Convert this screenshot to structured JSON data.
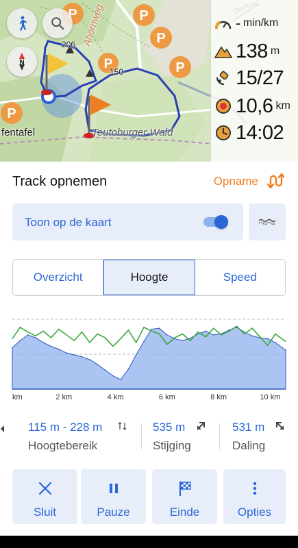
{
  "map": {
    "labels": {
      "road": "Ahornweg",
      "height1": "206",
      "height2": "150",
      "place_left": "fentafel",
      "place_bottom": "Teutoburger Wald",
      "road_top": "genbac"
    },
    "compass": "N"
  },
  "widgets": {
    "speed": {
      "value": "-",
      "unit": "min/km"
    },
    "altitude": {
      "value": "138",
      "unit": "m"
    },
    "satellites": {
      "value": "15/27"
    },
    "distance": {
      "value": "10,6",
      "unit": "km"
    },
    "time": {
      "value": "14:02"
    }
  },
  "sheet": {
    "title": "Track opnemen",
    "record_label": "Opname",
    "show_on_map_label": "Toon op de kaart",
    "tabs": [
      "Overzicht",
      "Hoogte",
      "Speed"
    ],
    "active_tab": "Hoogte"
  },
  "chart_data": {
    "type": "area",
    "xlabel": "",
    "ylabel": "",
    "x_tick_labels": [
      "km",
      "2 km",
      "4 km",
      "6 km",
      "8 km",
      "10 km"
    ],
    "x_ticks": [
      0,
      2,
      4,
      6,
      8,
      10
    ],
    "xlim": [
      0,
      10.6
    ],
    "series": [
      {
        "x": [
          0,
          0.3,
          0.6,
          0.9,
          1.2,
          1.5,
          1.8,
          2.1,
          2.4,
          2.7,
          3.0,
          3.3,
          3.6,
          3.9,
          4.2,
          4.5,
          4.8,
          5.1,
          5.4,
          5.7,
          6.0,
          6.3,
          6.6,
          6.9,
          7.2,
          7.5,
          7.8,
          8.1,
          8.4,
          8.7,
          9.0,
          9.3,
          9.6,
          9.9,
          10.2,
          10.6
        ],
        "values": [
          185,
          200,
          212,
          206,
          196,
          188,
          182,
          174,
          170,
          166,
          160,
          150,
          138,
          126,
          118,
          140,
          170,
          198,
          224,
          226,
          212,
          204,
          200,
          205,
          214,
          220,
          212,
          214,
          222,
          228,
          218,
          210,
          206,
          204,
          196,
          180
        ]
      },
      {
        "x": [
          0,
          0.3,
          0.6,
          0.9,
          1.2,
          1.5,
          1.8,
          2.1,
          2.4,
          2.7,
          3.0,
          3.3,
          3.6,
          3.9,
          4.2,
          4.5,
          4.8,
          5.1,
          5.4,
          5.7,
          6.0,
          6.3,
          6.6,
          6.9,
          7.2,
          7.5,
          7.8,
          8.1,
          8.4,
          8.7,
          9.0,
          9.3,
          9.6,
          9.9,
          10.2,
          10.6
        ],
        "values": [
          204,
          228,
          218,
          210,
          220,
          206,
          224,
          212,
          200,
          218,
          196,
          214,
          206,
          188,
          204,
          222,
          196,
          228,
          220,
          214,
          192,
          206,
          214,
          200,
          218,
          208,
          226,
          212,
          220,
          230,
          214,
          226,
          208,
          190,
          214,
          198
        ]
      }
    ],
    "grid": true
  },
  "stats": [
    {
      "value": "115 m - 228 m",
      "label": "Hoogtebereik"
    },
    {
      "value": "535 m",
      "label": "Stijging"
    },
    {
      "value": "531 m",
      "label": "Daling"
    }
  ],
  "actions": [
    {
      "label": "Sluit",
      "icon": "close-icon"
    },
    {
      "label": "Pauze",
      "icon": "pause-icon"
    },
    {
      "label": "Einde",
      "icon": "finish-flag-icon"
    },
    {
      "label": "Opties",
      "icon": "more-vertical-icon"
    }
  ],
  "colors": {
    "accent": "#2a66d6",
    "record_orange": "#ef7d21",
    "elevation_fill": "#8fb0ec",
    "slope_green": "#3aa83a",
    "track_blue": "#2b3fb4"
  }
}
